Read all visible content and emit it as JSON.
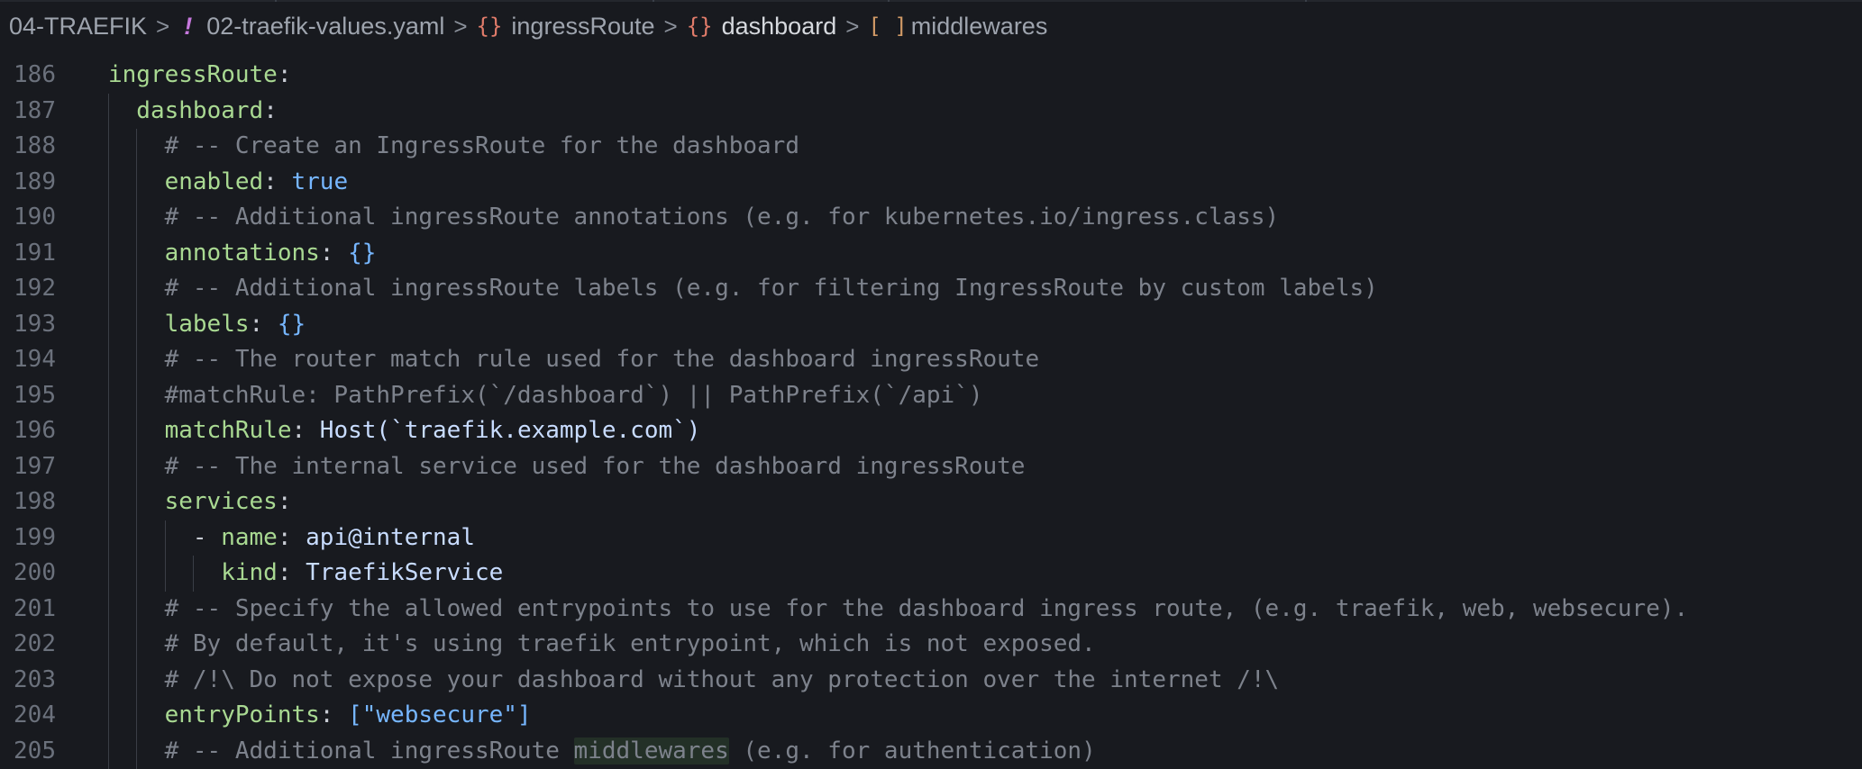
{
  "breadcrumb": {
    "items": [
      {
        "label": "04-TRAEFIK",
        "icon": "",
        "icon_name": "folder"
      },
      {
        "label": "02-traefik-values.yaml",
        "icon": "!",
        "icon_name": "yaml-file-icon"
      },
      {
        "label": "ingressRoute",
        "icon": "{}",
        "icon_name": "object-icon"
      },
      {
        "label": "dashboard",
        "icon": "{}",
        "icon_name": "object-icon"
      },
      {
        "label": "middlewares",
        "icon": "[ ]",
        "icon_name": "array-icon"
      }
    ],
    "separator": ">"
  },
  "editor": {
    "lines": [
      {
        "n": "186",
        "indent": 0,
        "parts": [
          [
            "k",
            "ingressRoute"
          ],
          [
            "p",
            ":"
          ]
        ]
      },
      {
        "n": "187",
        "indent": 1,
        "parts": [
          [
            "k",
            "dashboard"
          ],
          [
            "p",
            ":"
          ]
        ]
      },
      {
        "n": "188",
        "indent": 2,
        "parts": [
          [
            "c",
            "# -- Create an IngressRoute for the dashboard"
          ]
        ]
      },
      {
        "n": "189",
        "indent": 2,
        "parts": [
          [
            "k",
            "enabled"
          ],
          [
            "p",
            ": "
          ],
          [
            "b",
            "true"
          ]
        ]
      },
      {
        "n": "190",
        "indent": 2,
        "parts": [
          [
            "c",
            "# -- Additional ingressRoute annotations (e.g. for kubernetes.io/ingress.class)"
          ]
        ]
      },
      {
        "n": "191",
        "indent": 2,
        "parts": [
          [
            "k",
            "annotations"
          ],
          [
            "p",
            ": "
          ],
          [
            "b",
            "{}"
          ]
        ]
      },
      {
        "n": "192",
        "indent": 2,
        "parts": [
          [
            "c",
            "# -- Additional ingressRoute labels (e.g. for filtering IngressRoute by custom labels)"
          ]
        ]
      },
      {
        "n": "193",
        "indent": 2,
        "parts": [
          [
            "k",
            "labels"
          ],
          [
            "p",
            ": "
          ],
          [
            "b",
            "{}"
          ]
        ]
      },
      {
        "n": "194",
        "indent": 2,
        "parts": [
          [
            "c",
            "# -- The router match rule used for the dashboard ingressRoute"
          ]
        ]
      },
      {
        "n": "195",
        "indent": 2,
        "parts": [
          [
            "c",
            "#matchRule: PathPrefix(`/dashboard`) || PathPrefix(`/api`)"
          ]
        ]
      },
      {
        "n": "196",
        "indent": 2,
        "parts": [
          [
            "k",
            "matchRule"
          ],
          [
            "p",
            ": "
          ],
          [
            "s",
            "Host(`traefik.example.com`)"
          ]
        ]
      },
      {
        "n": "197",
        "indent": 2,
        "parts": [
          [
            "c",
            "# -- The internal service used for the dashboard ingressRoute"
          ]
        ]
      },
      {
        "n": "198",
        "indent": 2,
        "parts": [
          [
            "k",
            "services"
          ],
          [
            "p",
            ":"
          ]
        ]
      },
      {
        "n": "199",
        "indent": 3,
        "parts": [
          [
            "p",
            "- "
          ],
          [
            "k",
            "name"
          ],
          [
            "p",
            ": "
          ],
          [
            "s",
            "api@internal"
          ]
        ]
      },
      {
        "n": "200",
        "indent": 4,
        "parts": [
          [
            "k",
            "kind"
          ],
          [
            "p",
            ": "
          ],
          [
            "s",
            "TraefikService"
          ]
        ]
      },
      {
        "n": "201",
        "indent": 2,
        "parts": [
          [
            "c",
            "# -- Specify the allowed entrypoints to use for the dashboard ingress route, (e.g. traefik, web, websecure)."
          ]
        ]
      },
      {
        "n": "202",
        "indent": 2,
        "parts": [
          [
            "c",
            "# By default, it's using traefik entrypoint, which is not exposed."
          ]
        ]
      },
      {
        "n": "203",
        "indent": 2,
        "parts": [
          [
            "c",
            "# /!\\ Do not expose your dashboard without any protection over the internet /!\\"
          ]
        ]
      },
      {
        "n": "204",
        "indent": 2,
        "parts": [
          [
            "k",
            "entryPoints"
          ],
          [
            "p",
            ": "
          ],
          [
            "b",
            "[\"websecure\"]"
          ]
        ]
      },
      {
        "n": "205",
        "indent": 2,
        "parts": [
          [
            "c",
            "# -- Additional ingressRoute "
          ],
          [
            "chl",
            "middlewares"
          ],
          [
            "c",
            " (e.g. for authentication)"
          ]
        ]
      }
    ]
  }
}
